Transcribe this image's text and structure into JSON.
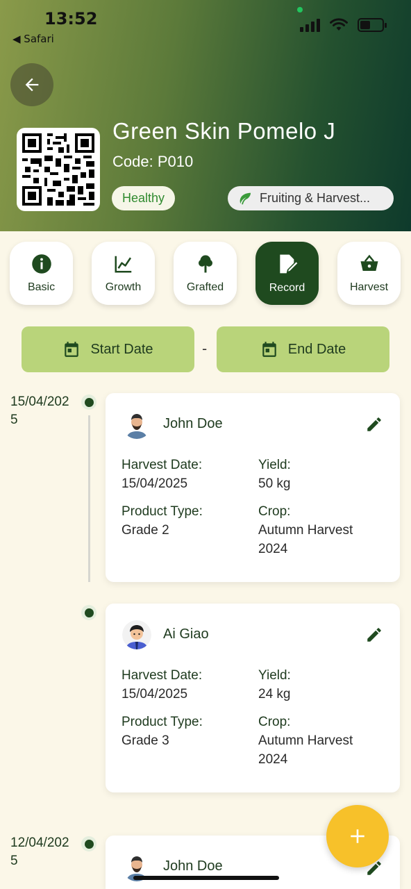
{
  "status_bar": {
    "time": "13:52",
    "back_app": "◀ Safari"
  },
  "plant": {
    "name": "Green Skin Pomelo J",
    "code": "Code: P010",
    "health": "Healthy",
    "stage": "Fruiting & Harvest..."
  },
  "tabs": [
    {
      "label": "Basic",
      "icon": "info-icon"
    },
    {
      "label": "Growth",
      "icon": "chart-line-icon"
    },
    {
      "label": "Grafted",
      "icon": "tree-icon"
    },
    {
      "label": "Record",
      "icon": "edit-note-icon",
      "active": true
    },
    {
      "label": "Harvest",
      "icon": "basket-icon"
    }
  ],
  "filters": {
    "start_label": "Start Date",
    "separator": "-",
    "end_label": "End Date"
  },
  "records": [
    {
      "date": "15/04/2025",
      "user": "John Doe",
      "harvest_date_label": "Harvest Date:",
      "harvest_date": "15/04/2025",
      "yield_label": "Yield:",
      "yield": "50 kg",
      "product_type_label": "Product Type:",
      "product_type": "Grade 2",
      "crop_label": "Crop:",
      "crop": "Autumn Harvest 2024"
    },
    {
      "date": "",
      "user": "Ai Giao",
      "harvest_date_label": "Harvest Date:",
      "harvest_date": "15/04/2025",
      "yield_label": "Yield:",
      "yield": "24 kg",
      "product_type_label": "Product Type:",
      "product_type": "Grade 3",
      "crop_label": "Crop:",
      "crop": "Autumn Harvest 2024"
    },
    {
      "date": "12/04/2025",
      "user": "John Doe"
    }
  ],
  "fab": {
    "icon": "plus-icon"
  },
  "colors": {
    "primary": "#1f4a1f",
    "accent": "#b9d47a",
    "fab": "#f7c12a",
    "health": "#2f8a2f"
  }
}
